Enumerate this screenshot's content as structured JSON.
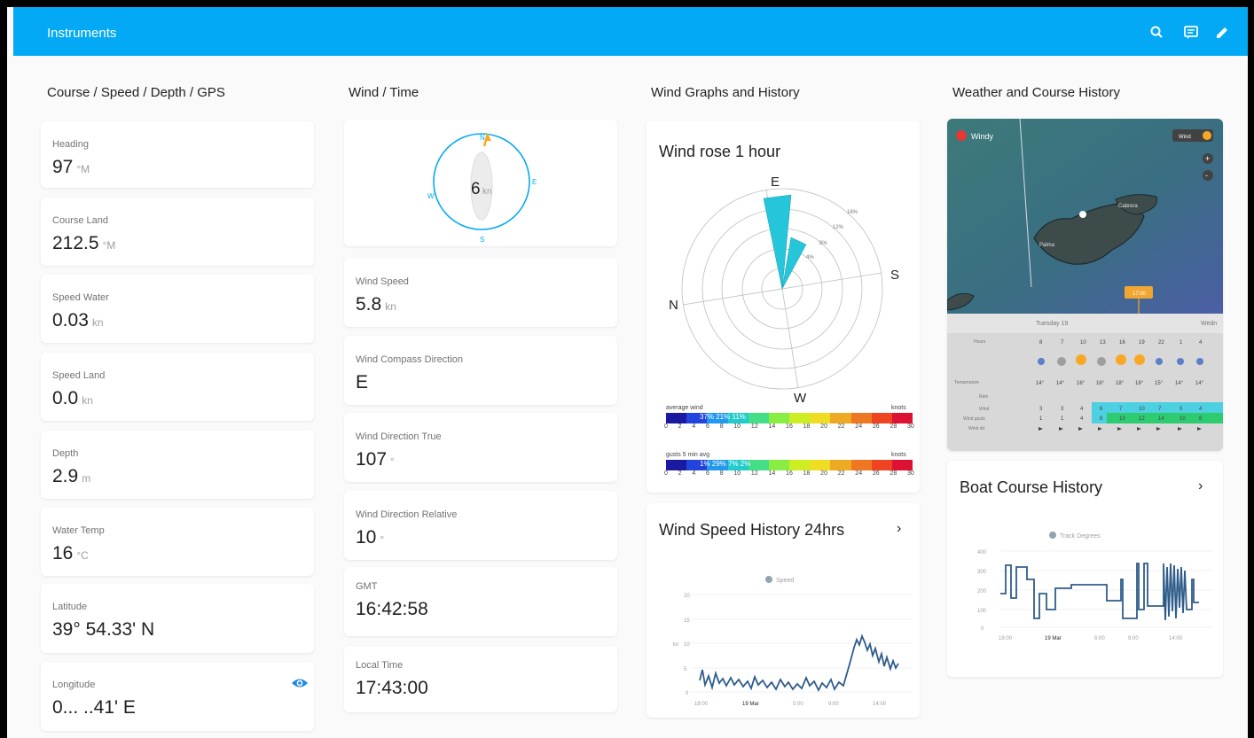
{
  "app": {
    "title": "Instruments"
  },
  "header": {
    "icons": [
      "search-icon",
      "message-icon",
      "pencil-icon"
    ]
  },
  "columns": {
    "c1": "Course / Speed / Depth / GPS",
    "c2": "Wind / Time",
    "c3": "Wind Graphs and History",
    "c4": "Weather and Course History"
  },
  "entities": [
    {
      "label": "Heading",
      "value": "97",
      "unit": "°M"
    },
    {
      "label": "Course Land",
      "value": "212.5",
      "unit": "°M"
    },
    {
      "label": "Speed Water",
      "value": "0.03",
      "unit": "kn"
    },
    {
      "label": "Speed Land",
      "value": "0.0",
      "unit": "kn"
    },
    {
      "label": "Depth",
      "value": "2.9",
      "unit": "m"
    },
    {
      "label": "Water Temp",
      "value": "16",
      "unit": "°C"
    },
    {
      "label": "Latitude",
      "value": "39° 54.33' N",
      "unit": ""
    },
    {
      "label": "Longitude",
      "value": "0... ..41' E",
      "unit": ""
    }
  ],
  "wind_gauge": {
    "value": "6",
    "unit": "kn",
    "marks": {
      "north": "N",
      "east": "E",
      "south": "S",
      "west": "W"
    }
  },
  "wind_entities": [
    {
      "label": "Wind Speed",
      "value": "5.8",
      "unit": "kn"
    },
    {
      "label": "Wind Compass Direction",
      "value": "E",
      "unit": ""
    },
    {
      "label": "Wind Direction True",
      "value": "107",
      "unit": "°"
    },
    {
      "label": "Wind Direction Relative",
      "value": "10",
      "unit": "°"
    },
    {
      "label": "GMT",
      "value": "16:42:58",
      "unit": ""
    },
    {
      "label": "Local Time",
      "value": "17:43:00",
      "unit": ""
    }
  ],
  "wind_rose": {
    "title": "Wind rose 1 hour",
    "directions": {
      "top": "E",
      "right": "S",
      "bottom": "W",
      "left": "N"
    },
    "rings": [
      "16%",
      "12%",
      "8%",
      "4%"
    ],
    "legend_avg": {
      "label": "average wind",
      "unit": "knots"
    },
    "legend_gust": {
      "label": "gusts 5 min avg",
      "unit": "knots"
    },
    "scale": [
      "0",
      "2",
      "4",
      "6",
      "8",
      "10",
      "12",
      "14",
      "16",
      "18",
      "20",
      "22",
      "24",
      "26",
      "28",
      "30"
    ],
    "colors": [
      "#1a1aa0",
      "#2244dd",
      "#2299ee",
      "#22cccc",
      "#44dd88",
      "#88ee44",
      "#ccee22",
      "#eedd22",
      "#eeaa22",
      "#ee7722",
      "#ee4422",
      "#dd1133"
    ],
    "percentages": {
      "avg": "37% 21% 11%",
      "gust": "1% 29% 7% 2%"
    }
  },
  "wind_speed_history": {
    "title": "Wind Speed History 24hrs",
    "legend": "Speed",
    "ylabel": "kn",
    "y_ticks": [
      "20",
      "15",
      "10",
      "5",
      "0"
    ],
    "x_ticks": [
      "18:00",
      "19 Mar",
      "5:00",
      "9:00",
      "14:00"
    ]
  },
  "map": {
    "brand": "Windy",
    "layer_button": "Wind",
    "place_labels": [
      "Palma",
      "Cabrera"
    ],
    "time_marker": "17:00",
    "day_labels": [
      "Tuesday 19",
      "Wedn"
    ],
    "row_labels": [
      "Hours",
      "",
      "Temperature",
      "Rain",
      "Wind",
      "Wind gusts",
      "Wind dir."
    ],
    "hours": [
      "8",
      "7",
      "10",
      "13",
      "16",
      "19",
      "22",
      "1",
      "4"
    ],
    "temps": [
      "14°",
      "14°",
      "16°",
      "16°",
      "18°",
      "18°",
      "15°",
      "14°",
      "14°"
    ],
    "wind_vals": [
      "3",
      "3",
      "4",
      "6",
      "7",
      "10",
      "7",
      "5",
      "4"
    ],
    "gust_vals": [
      "1",
      "1",
      "4",
      "8",
      "10",
      "12",
      "14",
      "10",
      "8"
    ]
  },
  "course_history": {
    "title": "Boat Course History",
    "legend": "Track Degrees",
    "y_ticks": [
      "400",
      "300",
      "200",
      "100",
      "0"
    ],
    "x_ticks": [
      "18:00",
      "19 Mar",
      "5:00",
      "9:00",
      "14:00"
    ]
  },
  "colors": {
    "header": "#03a9f4",
    "accent": "#1e88e5",
    "line": "#2f5d8a",
    "gauge_ring": "#03a9f4",
    "rose": "#26c6da",
    "sun": "#f9a825"
  }
}
